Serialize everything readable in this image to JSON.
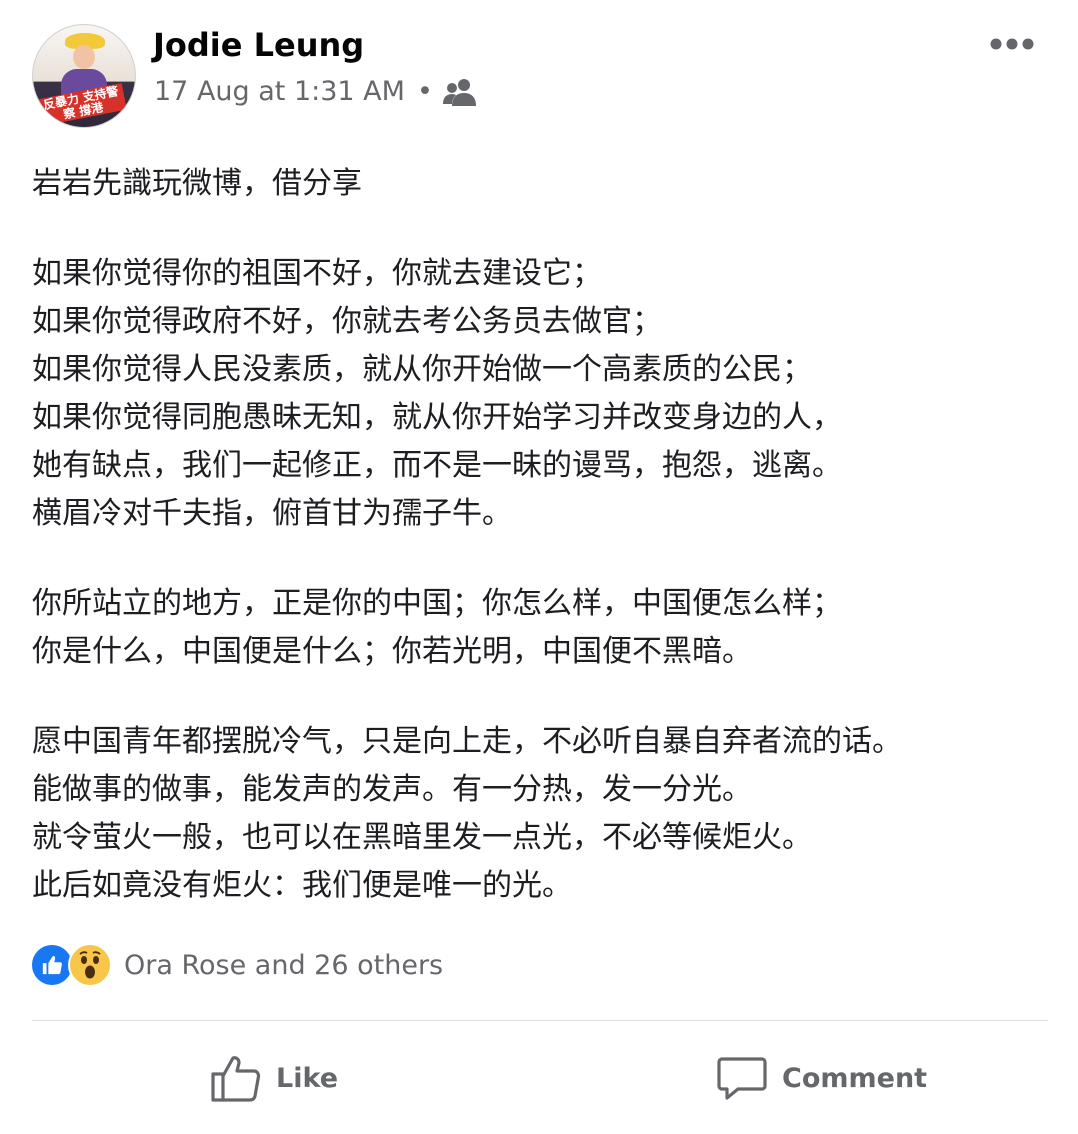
{
  "post": {
    "author": "Jodie Leung",
    "timestamp": "17 Aug at 1:31 AM",
    "separator": "•",
    "audience_icon": "friends-icon",
    "avatar_banner": "反暴力 支持警察 撐港",
    "paragraphs": [
      [
        "岩岩先識玩微博，借分享"
      ],
      [
        "如果你觉得你的祖国不好，你就去建设它；",
        "如果你觉得政府不好，你就去考公务员去做官；",
        "如果你觉得人民没素质，就从你开始做一个高素质的公民；",
        "如果你觉得同胞愚昧无知，就从你开始学习并改变身边的人，",
        "她有缺点，我们一起修正，而不是一昧的谩骂，抱怨，逃离。",
        "横眉冷对千夫指，俯首甘为孺子牛。"
      ],
      [
        "你所站立的地方，正是你的中国；你怎么样，中国便怎么样；",
        "你是什么，中国便是什么；你若光明，中国便不黑暗。"
      ],
      [
        "愿中国青年都摆脱冷气，只是向上走，不必听自暴自弃者流的话。",
        "能做事的做事，能发声的发声。有一分热，发一分光。",
        "就令萤火一般，也可以在黑暗里发一点光，不必等候炬火。",
        "此后如竟没有炬火：我们便是唯一的光。"
      ]
    ]
  },
  "reactions": {
    "icons": [
      "like-reaction-icon",
      "wow-reaction-icon"
    ],
    "summary": "Ora Rose and 26 others"
  },
  "actions": {
    "like_label": "Like",
    "comment_label": "Comment"
  },
  "colors": {
    "like_blue": "#1877f2",
    "wow_yellow": "#f7c64a",
    "muted_text": "#65676b"
  }
}
